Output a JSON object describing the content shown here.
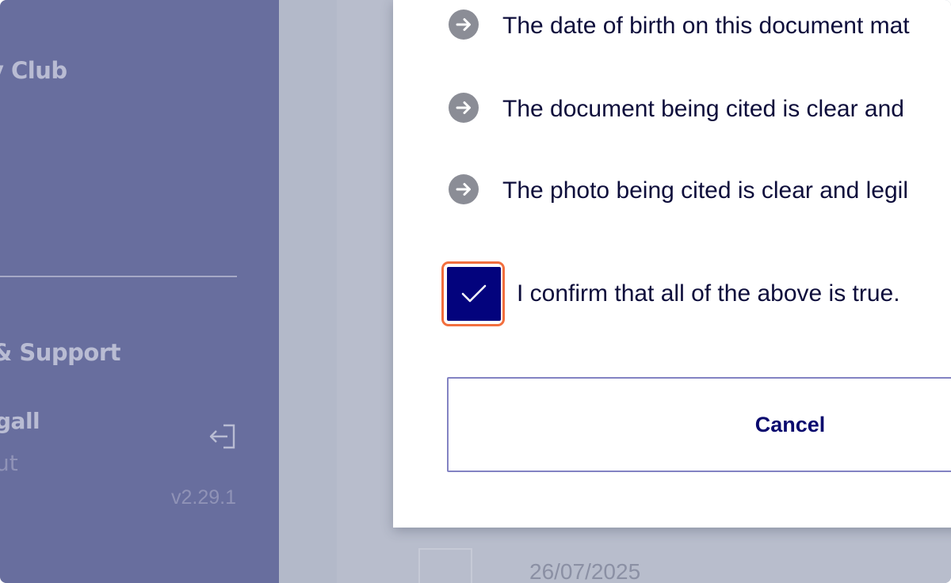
{
  "sidebar": {
    "brand": "y Club",
    "help_label": "& Support",
    "user_name": "gall",
    "user_sub": "ut",
    "version": "v2.29.1",
    "logout_icon": "logout-icon"
  },
  "modal": {
    "items": [
      {
        "text": "The date of birth on this document mat",
        "icon": "arrow-right-circle-icon"
      },
      {
        "text": "The document being cited is clear and",
        "icon": "arrow-right-circle-icon"
      },
      {
        "text": "The photo being cited is clear and legil",
        "icon": "arrow-right-circle-icon"
      }
    ],
    "confirm_label": "I confirm that all of the above is true.",
    "confirm_checked": true,
    "cancel_label": "Cancel"
  },
  "background": {
    "date": "26/07/2025"
  },
  "colors": {
    "accent": "#03037d",
    "highlight": "#f26f3e",
    "sidebar": "#686e9e",
    "text": "#0d0d3b"
  }
}
